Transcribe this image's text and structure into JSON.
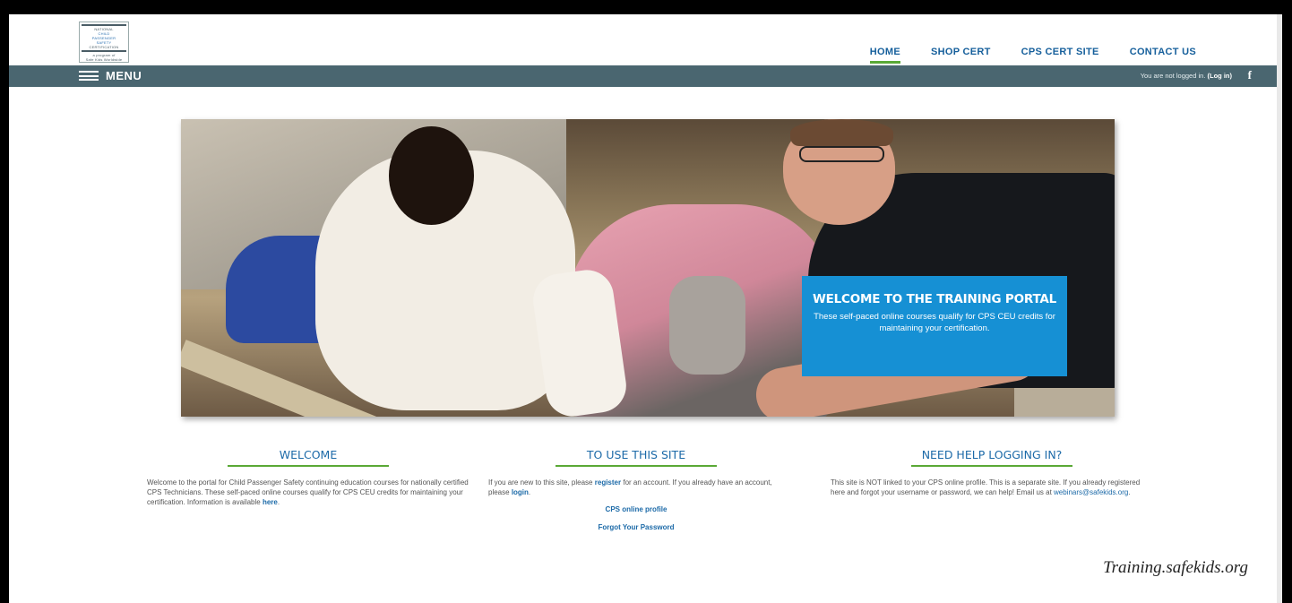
{
  "logo": {
    "lines": [
      "NATIONAL",
      "CHILD",
      "PASSENGER",
      "SAFETY",
      "CERTIFICATION",
      "a program of",
      "Safe Kids Worldwide"
    ]
  },
  "nav": {
    "items": [
      "HOME",
      "SHOP CERT",
      "CPS CERT SITE",
      "CONTACT US"
    ],
    "active": "HOME",
    "accent_color": "#5aa936",
    "link_color": "#17609c"
  },
  "menubar": {
    "label": "MENU",
    "login_status": "You are not logged in.",
    "login_link": "(Log in)",
    "social_icon": "facebook-icon",
    "bg_color": "#4a6670"
  },
  "hero": {
    "title": "WELCOME TO THE TRAINING PORTAL",
    "text": "These self-paced online courses qualify for CPS CEU credits for maintaining your certification.",
    "box_color": "#1690d4"
  },
  "columns": {
    "welcome": {
      "title": "WELCOME",
      "text": "Welcome to the portal for Child Passenger Safety continuing education courses for nationally certified CPS Technicians. These self-paced online courses qualify for CPS CEU credits for maintaining your certification. Information is available",
      "link": "here",
      "after_link": "."
    },
    "use_site": {
      "title": "TO USE THIS SITE",
      "text_1": "If you are new to this site, please",
      "register_link": "register",
      "text_2": "for an account. If you already have an account, please",
      "login_link": "login",
      "text_3": ".",
      "links": [
        "CPS online profile",
        "Forgot Your Password"
      ]
    },
    "help": {
      "title": "NEED HELP LOGGING IN?",
      "text": "This site is NOT linked to your CPS online profile. This is a separate site. If you already registered here and forgot your username or password, we can help! Email us at",
      "email": "webinars@safekids.org",
      "after_email": "."
    }
  },
  "caption": "Training.safekids.org"
}
